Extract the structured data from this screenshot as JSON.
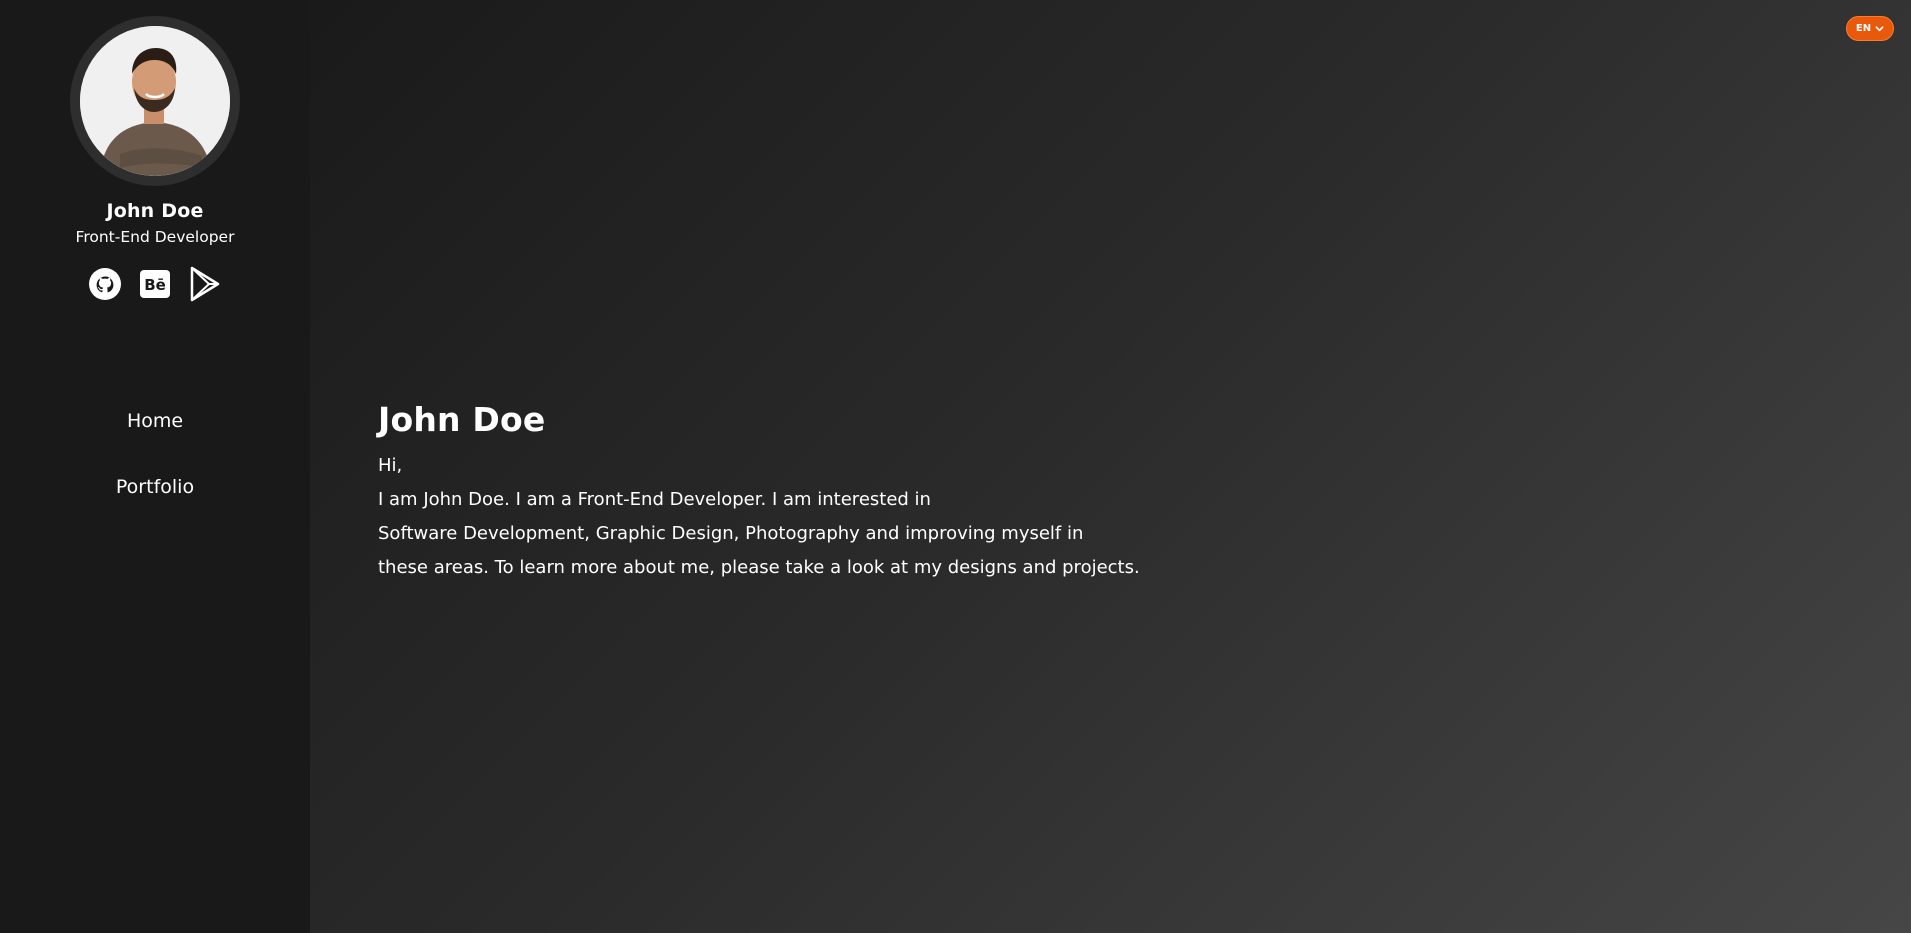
{
  "profile": {
    "name": "John Doe",
    "role": "Front-End Developer"
  },
  "socials": [
    {
      "icon": "github-icon"
    },
    {
      "icon": "behance-icon"
    },
    {
      "icon": "google-play-icon"
    }
  ],
  "nav": {
    "home": "Home",
    "portfolio": "Portfolio"
  },
  "language": {
    "selected": "EN"
  },
  "intro": {
    "title": "John Doe",
    "greeting": "Hi,",
    "lines": [
      "I am John Doe. I am a Front-End Developer. I am interested in",
      "Software Development, Graphic Design, Photography and improving myself in",
      "these areas. To learn more about me, please take a look at my designs and projects."
    ]
  },
  "colors": {
    "accent": "#e8590c",
    "sidebar_bg": "#191919",
    "text": "#ffffff"
  }
}
